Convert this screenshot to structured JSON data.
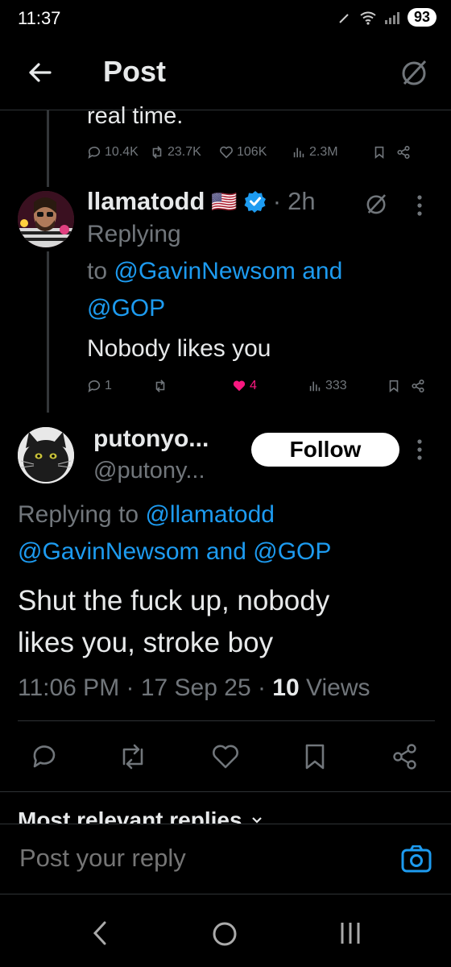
{
  "status_bar": {
    "time": "11:37",
    "battery": "93"
  },
  "header": {
    "title": "Post"
  },
  "parent_tweet": {
    "text_fragment": "real time.",
    "replies": "10.4K",
    "reposts": "23.7K",
    "likes": "106K",
    "views": "2.3M"
  },
  "reply_tweet": {
    "display_name": "llamatodd",
    "flag": "🇺🇸",
    "time_ago": "2h",
    "replying_label": "Replying",
    "replying_to_prefix": "to",
    "mention_1": "@GavinNewsom",
    "and_word": "and",
    "mention_2": "@GOP",
    "text": "Nobody likes you",
    "replies": "1",
    "likes": "4",
    "views": "333"
  },
  "main_tweet": {
    "display_name": "putonyo...",
    "handle": "@putony...",
    "follow_label": "Follow",
    "replying_prefix": "Replying to",
    "mention_1": "@llamatodd",
    "mention_2": "@GavinNewsom",
    "and_word": "and",
    "mention_3": "@GOP",
    "text_line_1": "Shut the fuck up, nobody",
    "text_line_2": "likes you, stroke boy",
    "timestamp": "11:06 PM · 17 Sep 25 · ",
    "views_count": "10",
    "views_label": "Views"
  },
  "replies_section": {
    "label": "Most relevant replies"
  },
  "reply_input": {
    "placeholder": "Post your reply"
  },
  "colors": {
    "accent": "#1d9bf0",
    "like_active": "#f91880",
    "muted": "#71767b",
    "background": "#000000"
  }
}
